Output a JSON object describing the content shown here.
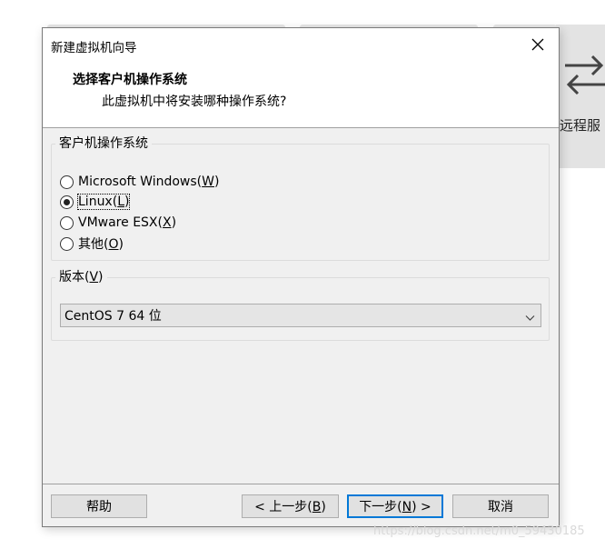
{
  "background": {
    "remote_label": "远程服"
  },
  "dialog": {
    "title": "新建虚拟机向导",
    "header_title": "选择客户机操作系统",
    "header_subtitle": "此虚拟机中将安装哪种操作系统?",
    "os_group": {
      "legend": "客户机操作系统",
      "options": [
        {
          "label": "Microsoft Windows(",
          "mnemonic": "W",
          "suffix": ")",
          "selected": false
        },
        {
          "label": "Linux(",
          "mnemonic": "L",
          "suffix": ")",
          "selected": true
        },
        {
          "label": "VMware ESX(",
          "mnemonic": "X",
          "suffix": ")",
          "selected": false
        },
        {
          "label": "其他(",
          "mnemonic": "O",
          "suffix": ")",
          "selected": false
        }
      ]
    },
    "version_group": {
      "legend": "版本(",
      "legend_mnemonic": "V",
      "legend_suffix": ")",
      "selected_value": "CentOS 7 64 位"
    },
    "buttons": {
      "help": "帮助",
      "back": "< 上一步(",
      "back_mnemonic": "B",
      "back_suffix": ")",
      "next": "下一步(",
      "next_mnemonic": "N",
      "next_suffix": ") >",
      "cancel": "取消"
    }
  },
  "watermark": "https://blog.csdn.net/m0_59430185",
  "colors": {
    "dialog_bg": "#f0f0f0",
    "accent": "#0078d7",
    "button_bg": "#e1e1e1"
  }
}
